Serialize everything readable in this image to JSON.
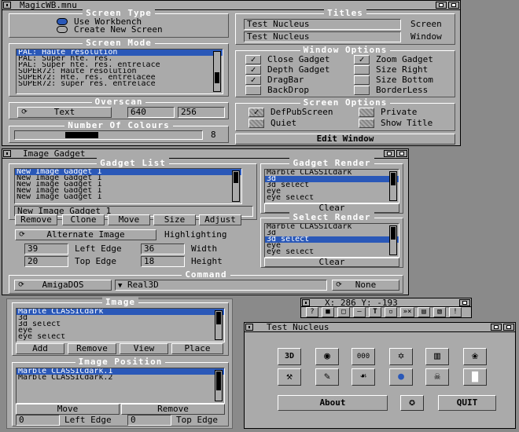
{
  "main_window": {
    "title": "MagicWB.mnu",
    "screen_type": {
      "label": "Screen Type",
      "options": [
        "Use Workbench",
        "Create New Screen"
      ]
    },
    "titles": {
      "label": "Titles",
      "screen_value": "Test Nucleus",
      "screen_label": "Screen",
      "window_value": "Test Nucleus",
      "window_label": "Window"
    },
    "screen_mode": {
      "label": "Screen Mode",
      "items": [
        "PAL: Haute résolution",
        "PAL: Super hte. rés.",
        "PAL: Super hte. rés. entrelacé",
        "SUPER72: Haute résolution",
        "SUPER72: Hte. rés. entrelacée",
        "SUPER72: super rés. entrelacé"
      ]
    },
    "window_options": {
      "label": "Window Options",
      "items": [
        {
          "label": "Close Gadget",
          "checked": true
        },
        {
          "label": "Zoom Gadget",
          "checked": true
        },
        {
          "label": "Depth Gadget",
          "checked": true
        },
        {
          "label": "Size Right",
          "checked": false
        },
        {
          "label": "DragBar",
          "checked": true
        },
        {
          "label": "Size Bottom",
          "checked": false
        },
        {
          "label": "BackDrop",
          "checked": false
        },
        {
          "label": "BorderLess",
          "checked": false
        }
      ]
    },
    "overscan": {
      "label": "Overscan",
      "mode": "Text",
      "width": "640",
      "height": "256"
    },
    "colours": {
      "label": "Number Of Colours",
      "value": "8"
    },
    "screen_options": {
      "label": "Screen Options",
      "items": [
        "DefPubScreen",
        "Private",
        "Quiet",
        "Show Title"
      ]
    },
    "edit_window_label": "Edit Window"
  },
  "image_gadget": {
    "title": "Image Gadget",
    "gadget_list": {
      "label": "Gadget List",
      "items": [
        "New Image Gadget 1",
        "New Image Gadget 1",
        "New Image Gadget 1",
        "New Image Gadget 1",
        "New Image Gadget 1"
      ],
      "current": "New Image Gadget 1"
    },
    "buttons": [
      "Remove",
      "Clone",
      "Move",
      "Size",
      "Adjust"
    ],
    "alternate_image": "Alternate Image",
    "highlighting": "Highlighting",
    "left_edge": {
      "value": "39",
      "label": "Left Edge"
    },
    "width": {
      "value": "36",
      "label": "Width"
    },
    "top_edge": {
      "value": "20",
      "label": "Top Edge"
    },
    "height": {
      "value": "18",
      "label": "Height"
    },
    "gadget_render": {
      "label": "Gadget Render",
      "items": [
        "Marble_CLASSICdark",
        "3d",
        "3d_select",
        "eye",
        "eye_select"
      ],
      "clear": "Clear"
    },
    "select_render": {
      "label": "Select Render",
      "items": [
        "Marble_CLASSICdark",
        "3d",
        "3d_select",
        "eye",
        "eye_select"
      ],
      "clear": "Clear"
    },
    "command": {
      "label": "Command",
      "type": "AmigaDOS",
      "value": "Real3D",
      "none": "None"
    }
  },
  "image_window": {
    "image": {
      "label": "Image",
      "items": [
        "Marble_CLASSICdark",
        "3d",
        "3d_select",
        "eye",
        "eye_select"
      ],
      "buttons": [
        "Add",
        "Remove",
        "View",
        "Place"
      ]
    },
    "position": {
      "label": "Image Position",
      "items": [
        "Marble_CLASSICdark.1",
        "Marble_CLASSICdark.2"
      ],
      "move": "Move",
      "remove": "Remove",
      "left_value": "0",
      "left_label": "Left Edge",
      "top_value": "0",
      "top_label": "Top Edge"
    }
  },
  "coords_toolbar": {
    "readout": "X: 286 Y: -193",
    "tools": [
      "?",
      "■",
      "□",
      "—",
      "T",
      "▫",
      "»×",
      "▤",
      "▧",
      "!"
    ]
  },
  "test_window": {
    "title": "Test Nucleus",
    "icons": [
      "3D",
      "◉",
      "000",
      "✡",
      "▥",
      "❀",
      "⚒",
      "✎",
      "☙",
      "●",
      "☠",
      "▇"
    ],
    "about": "About",
    "quit": "QUIT"
  }
}
